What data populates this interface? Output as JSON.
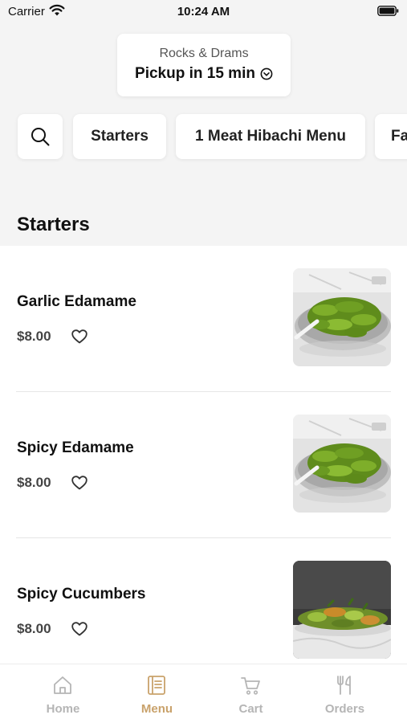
{
  "status_bar": {
    "carrier": "Carrier",
    "time": "10:24 AM"
  },
  "store": {
    "name": "Rocks & Drams",
    "pickup": "Pickup in 15 min"
  },
  "categories": [
    {
      "label": "Starters"
    },
    {
      "label": "1 Meat Hibachi Menu"
    },
    {
      "label": "Fa"
    }
  ],
  "section": {
    "title": "Starters"
  },
  "items": [
    {
      "name": "Garlic Edamame",
      "price": "$8.00",
      "image": "edamame-bowl"
    },
    {
      "name": "Spicy Edamame",
      "price": "$8.00",
      "image": "edamame-bowl"
    },
    {
      "name": "Spicy Cucumbers",
      "price": "$8.00",
      "image": "cucumber-plate"
    }
  ],
  "tabs": [
    {
      "label": "Home",
      "icon": "home-icon",
      "active": false
    },
    {
      "label": "Menu",
      "icon": "menu-book-icon",
      "active": true
    },
    {
      "label": "Cart",
      "icon": "cart-icon",
      "active": false
    },
    {
      "label": "Orders",
      "icon": "fork-knife-icon",
      "active": false
    }
  ],
  "colors": {
    "accent": "#c9a26b",
    "inactive": "#b5b5b5",
    "background_top": "#f4f4f4"
  }
}
